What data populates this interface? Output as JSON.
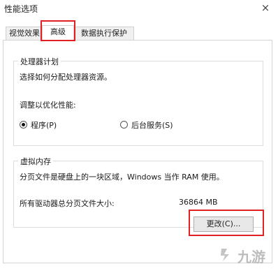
{
  "window": {
    "title": "性能选项",
    "close_glyph": "×"
  },
  "tabs": [
    {
      "label": "视觉效果",
      "active": false
    },
    {
      "label": "高级",
      "active": true
    },
    {
      "label": "数据执行保护",
      "active": false
    }
  ],
  "processor": {
    "group_title": "处理器计划",
    "description": "选择如何分配处理器资源。",
    "adjust_label": "调整以优化性能:",
    "options": [
      {
        "label": "程序(P)",
        "checked": true
      },
      {
        "label": "后台服务(S)",
        "checked": false
      }
    ]
  },
  "virtual_memory": {
    "group_title": "虚拟内存",
    "description": "分页文件是硬盘上的一块区域，Windows 当作 RAM 使用。",
    "total_label": "所有驱动器总分页文件大小:",
    "total_value": "36864 MB",
    "change_button": "更改(C)..."
  },
  "highlight_color": "#e02020",
  "watermark": {
    "text": "九游",
    "icon": "watermark-logo-icon"
  }
}
